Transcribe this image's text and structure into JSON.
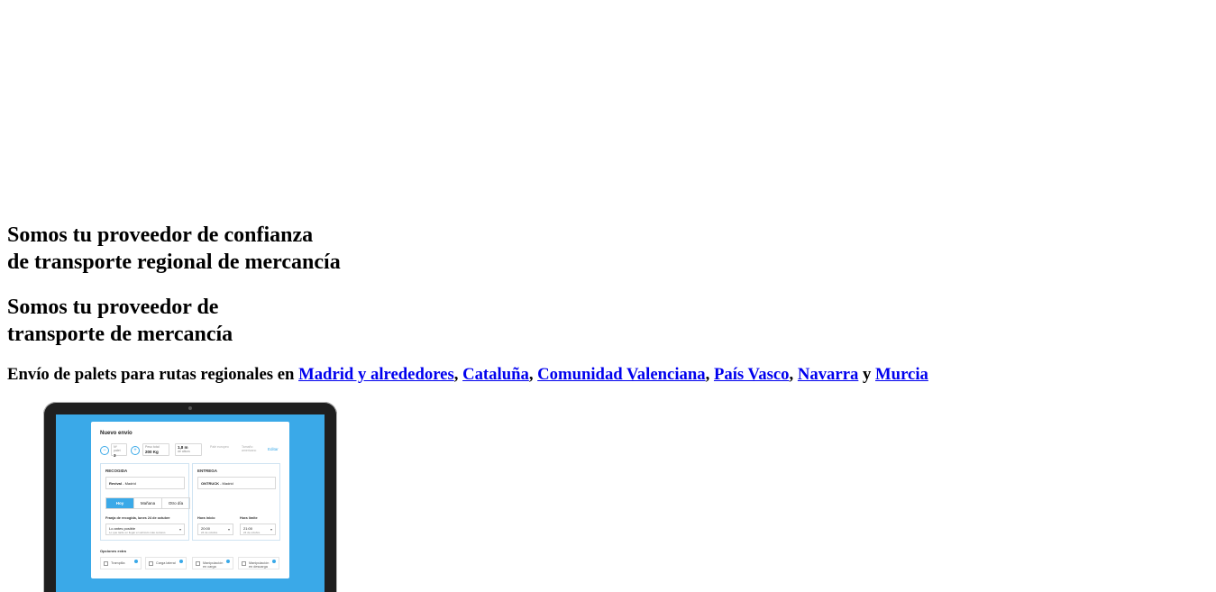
{
  "hero": {
    "title_line1": "Somos tu proveedor de confianza",
    "title_line2": "de transporte regional de mercancía",
    "alt_title_line1": "Somos tu proveedor de",
    "alt_title_line2": "transporte de mercancía"
  },
  "subtitle": {
    "prefix": "Envío de palets para rutas regionales en ",
    "links": [
      "Madrid y alrededores",
      "Cataluña",
      "Comunidad Valenciana",
      "País Vasco",
      "Navarra",
      "Murcia"
    ],
    "sep": ", ",
    "and": " y "
  },
  "mockup": {
    "card_title": "Nuevo envío",
    "top_row": {
      "palets_label": "Nº palet",
      "palets_value": "3",
      "weight_label": "Peso total",
      "weight_value": "200",
      "weight_unit": "Kg",
      "height_value": "1,8 m",
      "height_label": "de altura",
      "field1": "Palé europeo",
      "field2": "Tamaño americano",
      "edit_link": "Editar"
    },
    "pickup": {
      "title": "RECOGIDA",
      "place_bold": "Revival",
      "place_rest": " - Madrid",
      "days": [
        "Hoy",
        "Mañana",
        "Otro día"
      ],
      "range_label": "Franja de recogida, lunes 24 de octubre",
      "range_value": "Lo antes posible",
      "range_sub": "Lo que tarde en llegar el vehículo más cercano"
    },
    "delivery": {
      "title": "ENTREGA",
      "place_bold": "ONTRUCK",
      "place_rest": " - Madrid",
      "start_label": "Hora inicio",
      "start_value": "20:00",
      "start_sub": "24 de octubre",
      "end_label": "Hora límite",
      "end_value": "21:00",
      "end_sub": "24 de octubre"
    },
    "extras_title": "Opciones extra",
    "extras": [
      "Trampilla",
      "Carga lateral",
      "Manipulación en carga",
      "Manipulación en descarga"
    ],
    "colors": {
      "screen_bg": "#3aa9e8",
      "laptop_frame": "#1f1f1f"
    }
  }
}
